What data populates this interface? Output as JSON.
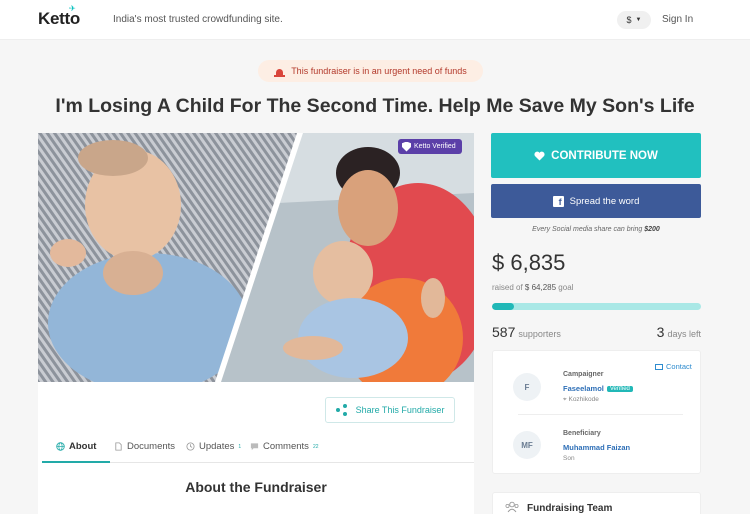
{
  "header": {
    "logo": "Ketto",
    "tagline": "India's most trusted crowdfunding site.",
    "currency": "$",
    "signin": "Sign In"
  },
  "urgent_banner": "This fundraiser is in an urgent need of funds",
  "title": "I'm Losing A Child For The Second Time. Help Me Save My Son's Life",
  "hero": {
    "badge": "Ketto Verified"
  },
  "share_label": "Share This Fundraiser",
  "tabs": [
    {
      "label": "About",
      "count": ""
    },
    {
      "label": "Documents",
      "count": ""
    },
    {
      "label": "Updates",
      "count": "1"
    },
    {
      "label": "Comments",
      "count": "22"
    }
  ],
  "about_heading": "About the Fundraiser",
  "actions": {
    "contribute": "CONTRIBUTE NOW",
    "spread": "Spread the word",
    "social_note_prefix": "Every Social media share can bring",
    "social_note_amount": "$200"
  },
  "stats": {
    "raised": "$ 6,835",
    "goal_prefix": "raised of",
    "goal_amount": "$ 64,285",
    "goal_suffix": "goal",
    "progress_fraction": 0.106,
    "supporters_count": "587",
    "supporters_label": "supporters",
    "days_count": "3",
    "days_label": "days left"
  },
  "people": {
    "contact": "Contact",
    "campaigner": {
      "role": "Campaigner",
      "initial": "F",
      "name": "Faseelamol",
      "badge": "Verified",
      "location": "Kozhikode"
    },
    "beneficiary": {
      "role": "Beneficiary",
      "initial": "MF",
      "name": "Muhammad Faizan",
      "relation": "Son"
    }
  },
  "team_title": "Fundraising Team",
  "colors": {
    "accent": "#21c0bf",
    "facebook": "#3d5a99",
    "verified": "#5b3fa8",
    "urgent_bg": "#fdeee4"
  }
}
